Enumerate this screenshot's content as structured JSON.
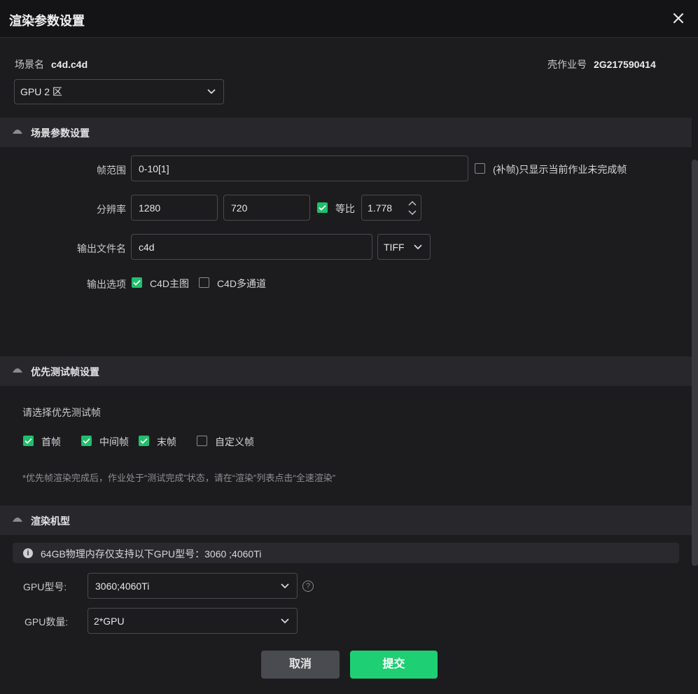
{
  "dialog": {
    "title": "渲染参数设置"
  },
  "scene": {
    "name_label": "场景名",
    "name_value": "c4d.c4d",
    "job_label": "壳作业号",
    "job_value": "2G217590414"
  },
  "zone_select": {
    "value": "GPU 2 区"
  },
  "sections": {
    "scene_params": "场景参数设置",
    "priority_frames": "优先测试帧设置",
    "render_machine": "渲染机型"
  },
  "frame_range": {
    "label": "帧范围",
    "value": "0-10[1]",
    "checkbox_label": "(补帧)只显示当前作业未完成帧",
    "checked": false
  },
  "resolution": {
    "label": "分辨率",
    "width": "1280",
    "height": "720",
    "ratio_label": "等比",
    "ratio_checked": true,
    "ratio_value": "1.778"
  },
  "output_file": {
    "label": "输出文件名",
    "value": "c4d",
    "format": "TIFF"
  },
  "output_options": {
    "label": "输出选项",
    "items": [
      {
        "label": "C4D主图",
        "checked": true
      },
      {
        "label": "C4D多通道",
        "checked": false
      }
    ]
  },
  "priority": {
    "prompt": "请选择优先测试帧",
    "items": [
      {
        "label": "首帧",
        "checked": true
      },
      {
        "label": "中间帧",
        "checked": true
      },
      {
        "label": "末帧",
        "checked": true
      },
      {
        "label": "自定义帧",
        "checked": false
      }
    ],
    "note": "*优先帧渲染完成后，作业处于“测试完成”状态，请在“渲染”列表点击“全速渲染”"
  },
  "machine": {
    "notice": "64GB物理内存仅支持以下GPU型号：3060 ;4060Ti",
    "gpu_model_label": "GPU型号:",
    "gpu_model_value": "3060;4060Ti",
    "gpu_count_label": "GPU数量:",
    "gpu_count_value": "2*GPU"
  },
  "buttons": {
    "cancel": "取消",
    "submit": "提交"
  },
  "colors": {
    "accent": "#1fcf73",
    "checkbox": "#1fbf6b",
    "background": "#1c1c1e",
    "section": "#28282c"
  },
  "icons": [
    "close-icon",
    "chevron-down-icon",
    "collapse-triangle-icon",
    "check-icon",
    "info-icon",
    "help-icon",
    "stepper-icon"
  ]
}
